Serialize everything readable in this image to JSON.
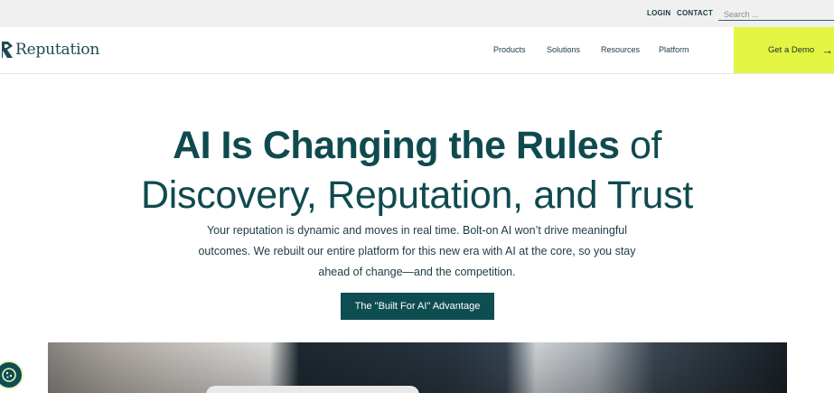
{
  "topbar": {
    "login": "LOGIN",
    "contact": "CONTACT",
    "search_placeholder": "Search ..."
  },
  "nav": {
    "brand": "Reputation",
    "items": [
      {
        "label": "Products"
      },
      {
        "label": "Solutions"
      },
      {
        "label": "Resources"
      },
      {
        "label": "Platform"
      }
    ],
    "demo_label": "Get a Demo"
  },
  "hero": {
    "title_bold": "AI Is Changing the Rules",
    "title_light": "of",
    "title_line2": "Discovery, Reputation, and Trust",
    "subtitle_line1": "Your reputation is dynamic and moves in real time. Bolt-on AI won’t drive meaningful",
    "subtitle_line2": "outcomes. We rebuilt our entire platform for this new era with AI at the core, so you stay",
    "subtitle_line3": "ahead of change—and the competition.",
    "cta_label": "The \"Built For AI\" Advantage"
  },
  "icons": {
    "logo": "reputation-logo-icon",
    "arrow": "arrow-right-icon",
    "cookie": "cookie-icon"
  },
  "colors": {
    "brand_teal": "#0f4a4f",
    "cta_bg": "#0e4d52",
    "demo_bg": "#e3f542",
    "topbar_bg": "#f0f0f0"
  }
}
